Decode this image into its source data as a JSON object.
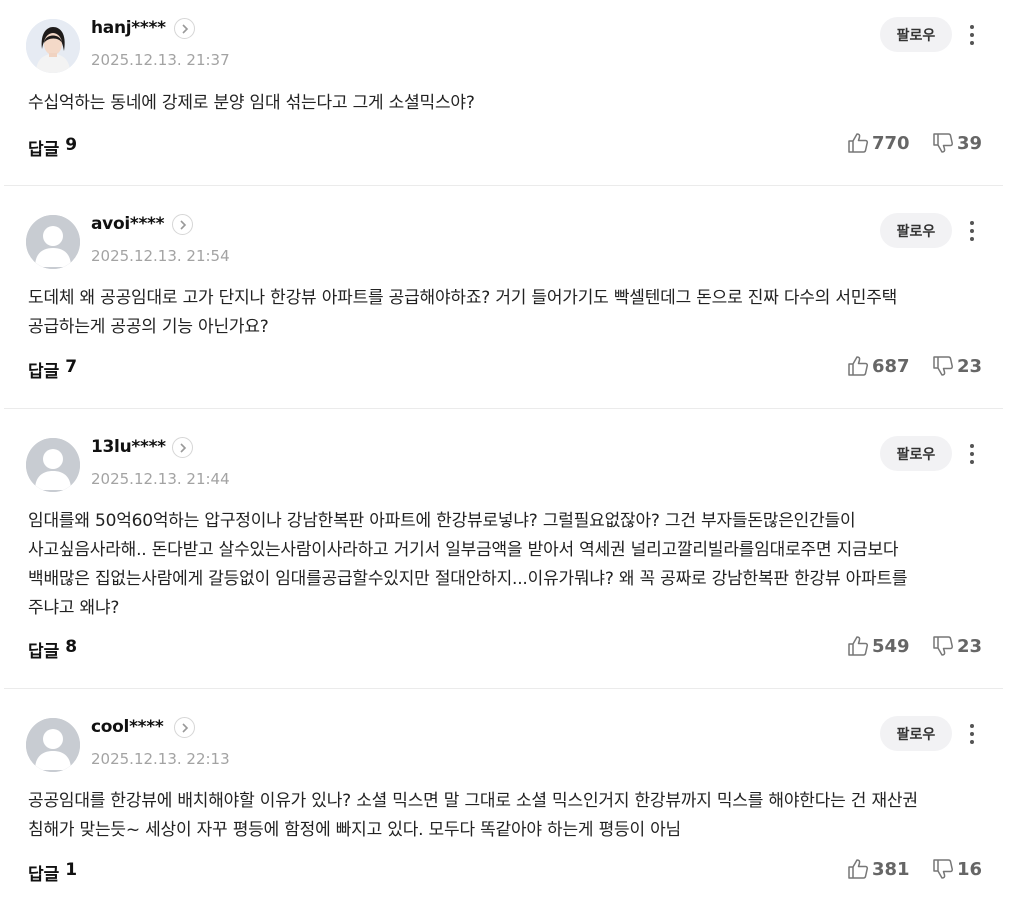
{
  "follow_label": "팔로우",
  "reply_label": "답글",
  "comments": [
    {
      "nickname": "hanj****",
      "date": "2025.12.13. 21:37",
      "text": "수십억하는 동네에 강제로 분양 임대 섞는다고 그게 소셜믹스야?",
      "replies": "9",
      "likes": "770",
      "dislikes": "39"
    },
    {
      "nickname": "avoi****",
      "date": "2025.12.13. 21:54",
      "text": "도데체 왜 공공임대로 고가 단지나 한강뷰 아파트를 공급해야하죠? 거기 들어가기도 빡셀텐데그 돈으로 진짜 다수의 서민주택 공급하는게 공공의 기능 아닌가요?",
      "replies": "7",
      "likes": "687",
      "dislikes": "23"
    },
    {
      "nickname": "13lu****",
      "date": "2025.12.13. 21:44",
      "text": "임대를왜 50억60억하는 압구정이나 강남한복판 아파트에 한강뷰로넣냐? 그럴필요없잖아? 그건 부자들돈많은인간들이 사고싶음사라해.. 돈다받고 살수있는사람이사라하고 거기서 일부금액을 받아서 역세권 널리고깔리빌라를임대로주면 지금보다 백배많은 집없는사람에게 갈등없이 임대를공급할수있지만 절대안하지...이유가뭐냐? 왜 꼭 공짜로 강남한복판 한강뷰 아파트를 주냐고 왜냐?",
      "replies": "8",
      "likes": "549",
      "dislikes": "23"
    },
    {
      "nickname": "cool****",
      "date": "2025.12.13. 22:13",
      "text": "공공임대를 한강뷰에 배치해야할 이유가 있나? 소셜 믹스면 말 그대로 소셜 믹스인거지 한강뷰까지 믹스를 해야한다는 건 재산권 침해가 맞는듯~ 세상이 자꾸 평등에 함정에 빠지고 있다. 모두다 똑같아야 하는게 평등이 아님",
      "replies": "1",
      "likes": "381",
      "dislikes": "16"
    }
  ]
}
